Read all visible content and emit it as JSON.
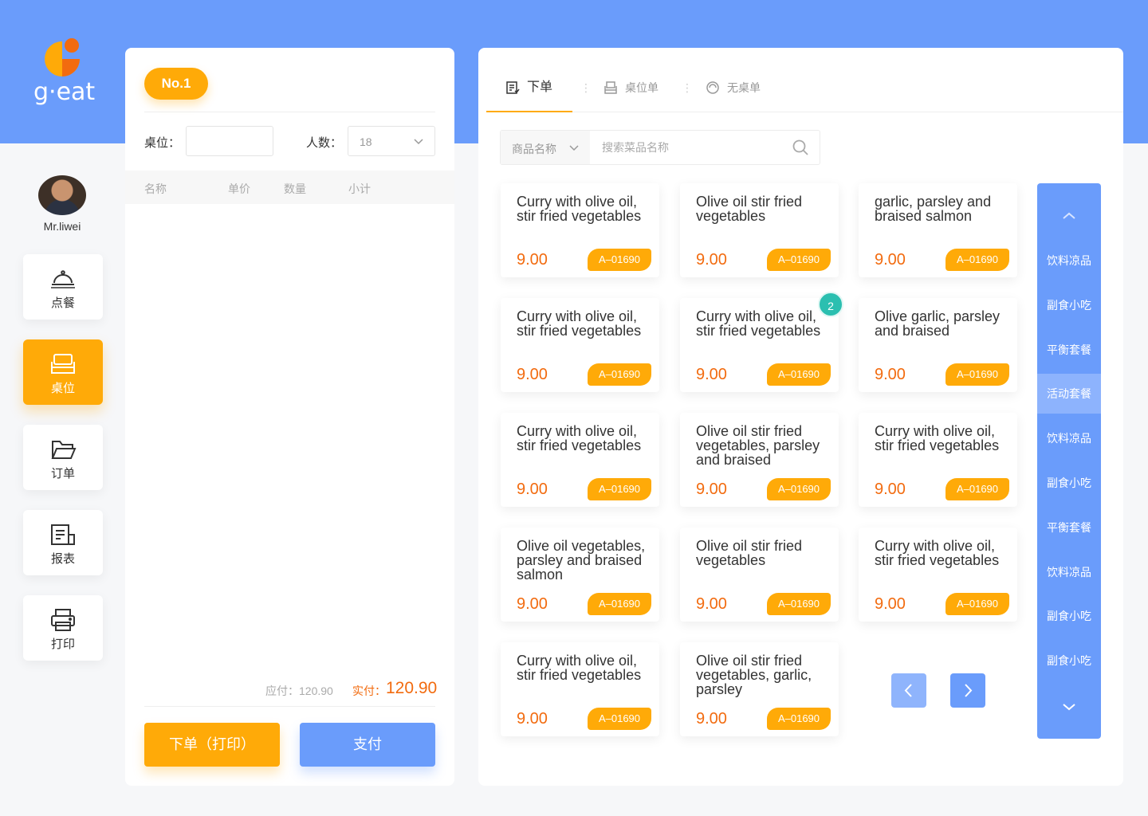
{
  "brand": {
    "name": "g·eat",
    "colors": {
      "accent": "#ffaa08",
      "primary": "#6a9cfb",
      "price": "#f26b0f",
      "badge": "#2bbfb0"
    }
  },
  "user": {
    "name": "Mr.liwei"
  },
  "nav": [
    {
      "label": "点餐",
      "icon": "cloche-icon"
    },
    {
      "label": "桌位",
      "icon": "seat-icon",
      "active": true
    },
    {
      "label": "订单",
      "icon": "folder-icon"
    },
    {
      "label": "报表",
      "icon": "report-icon"
    },
    {
      "label": "打印",
      "icon": "printer-icon"
    }
  ],
  "order": {
    "badge": "No.1",
    "seat_label": "桌位：",
    "seat_value": "",
    "people_label": "人数：",
    "people_value": "18",
    "columns": [
      "名称",
      "单价",
      "数量",
      "小计"
    ],
    "due_label": "应付：120.90",
    "paid_label": "实付：",
    "paid_value": "120.90",
    "submit_label": "下单（打印）",
    "pay_label": "支付"
  },
  "tabs": [
    {
      "label": "下单",
      "icon": "order-icon",
      "active": true
    },
    {
      "label": "桌位单",
      "icon": "table-icon"
    },
    {
      "label": "无桌单",
      "icon": "circle-icon"
    }
  ],
  "search": {
    "category": "商品名称",
    "placeholder": "搜索菜品名称"
  },
  "products": [
    {
      "name": "Curry with olive oil, stir fried vegetables",
      "price": "9.00",
      "code": "A–01690"
    },
    {
      "name": "Olive oil stir fried vegetables",
      "price": "9.00",
      "code": "A–01690"
    },
    {
      "name": "garlic, parsley and braised salmon",
      "price": "9.00",
      "code": "A–01690"
    },
    {
      "name": "Curry with olive oil, stir fried vegetables",
      "price": "9.00",
      "code": "A–01690"
    },
    {
      "name": "Curry with olive oil, stir fried vegetables",
      "price": "9.00",
      "code": "A–01690",
      "qty": "2"
    },
    {
      "name": "Olive garlic, parsley and braised",
      "price": "9.00",
      "code": "A–01690"
    },
    {
      "name": "Curry with olive oil, stir fried vegetables",
      "price": "9.00",
      "code": "A–01690"
    },
    {
      "name": "Olive oil stir fried vegetables, parsley and braised",
      "price": "9.00",
      "code": "A–01690"
    },
    {
      "name": "Curry with olive oil, stir fried vegetables",
      "price": "9.00",
      "code": "A–01690"
    },
    {
      "name": "Olive oil vegetables, parsley and braised salmon",
      "price": "9.00",
      "code": "A–01690"
    },
    {
      "name": "Olive oil stir fried vegetables",
      "price": "9.00",
      "code": "A–01690"
    },
    {
      "name": "Curry with olive oil, stir fried vegetables",
      "price": "9.00",
      "code": "A–01690"
    },
    {
      "name": "Curry with olive oil, stir fried vegetables",
      "price": "9.00",
      "code": "A–01690"
    },
    {
      "name": "Olive oil stir fried vegetables, garlic, parsley",
      "price": "9.00",
      "code": "A–01690"
    }
  ],
  "categories": [
    {
      "label": "饮料凉品"
    },
    {
      "label": "副食小吃"
    },
    {
      "label": "平衡套餐"
    },
    {
      "label": "活动套餐",
      "active": true
    },
    {
      "label": "饮料凉品"
    },
    {
      "label": "副食小吃"
    },
    {
      "label": "平衡套餐"
    },
    {
      "label": "饮料凉品"
    },
    {
      "label": "副食小吃"
    },
    {
      "label": "副食小吃"
    }
  ]
}
